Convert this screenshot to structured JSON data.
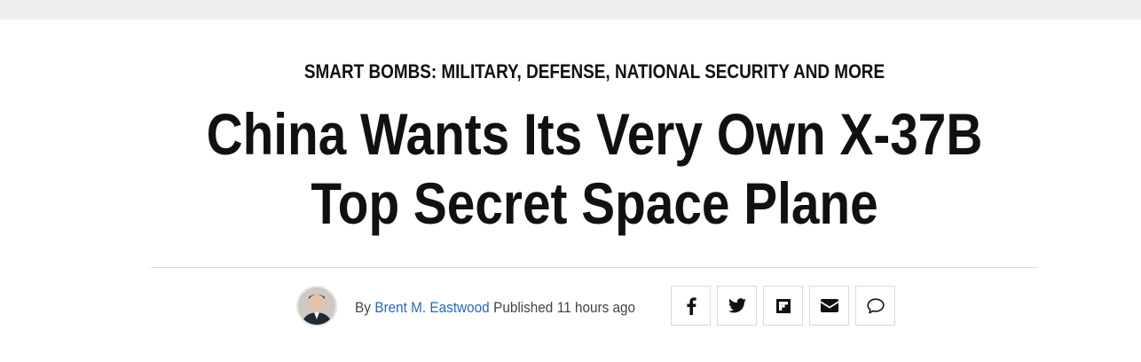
{
  "article": {
    "kicker": "SMART BOMBS: MILITARY, DEFENSE, NATIONAL SECURITY AND MORE",
    "headline": "China Wants Its Very Own X-37B Top Secret Space Plane"
  },
  "byline": {
    "by": "By",
    "author": "Brent M. Eastwood",
    "published_label": "Published",
    "time": "11 hours ago"
  },
  "share": {
    "icons": [
      "facebook-icon",
      "twitter-icon",
      "flipboard-icon",
      "email-icon",
      "comment-icon"
    ]
  }
}
